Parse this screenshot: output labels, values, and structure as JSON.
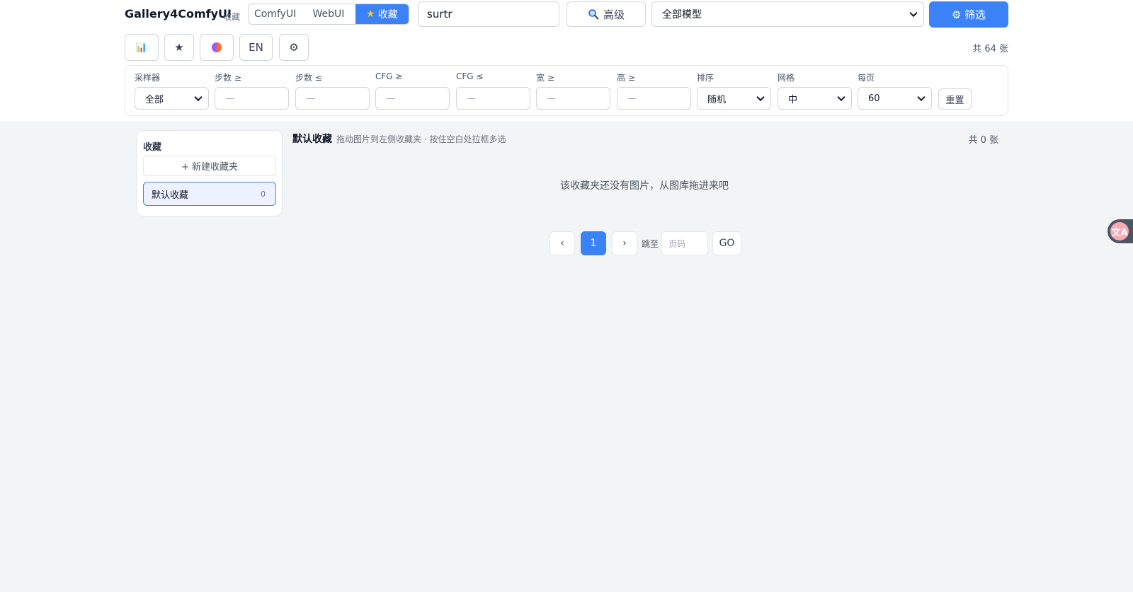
{
  "header": {
    "brand": "Gallery4ComfyUI",
    "brand_sub": "收藏",
    "sources": [
      {
        "label": "ComfyUI",
        "active": false
      },
      {
        "label": "WebUI",
        "active": false
      },
      {
        "label": "收藏",
        "active": true,
        "icon": "star-icon"
      }
    ],
    "search_value": "surtr",
    "advanced_label": "高级",
    "advanced_icon": "magnifier-icon",
    "model_select_value": "全部模型",
    "filter_button_label": "⚙ 筛选",
    "icon_buttons": [
      {
        "label": "📊",
        "icon": "bar-chart-icon"
      },
      {
        "label": "★",
        "icon": "star-icon"
      },
      {
        "label": "◑",
        "icon": "theme-icon"
      },
      {
        "label": "EN",
        "icon": "language-toggle"
      },
      {
        "label": "⚙",
        "icon": "settings-icon"
      }
    ],
    "total_text": "共 64 张"
  },
  "filters": {
    "sampler": {
      "label": "采样器",
      "value": "全部"
    },
    "steps_min": {
      "label": "步数 ≥",
      "placeholder": "—"
    },
    "steps_max": {
      "label": "步数 ≤",
      "placeholder": "—"
    },
    "cfg_min": {
      "label": "CFG ≥",
      "placeholder": "—"
    },
    "cfg_max": {
      "label": "CFG ≤",
      "placeholder": "—"
    },
    "width_min": {
      "label": "宽 ≥",
      "placeholder": "—"
    },
    "height_min": {
      "label": "高 ≥",
      "placeholder": "—"
    },
    "sort": {
      "label": "排序",
      "value": "随机"
    },
    "grid": {
      "label": "网格",
      "value": "中"
    },
    "per_page": {
      "label": "每页",
      "value": "60"
    },
    "reset_label": "重置"
  },
  "sidebar": {
    "title": "收藏",
    "new_folder_label": "+ 新建收藏夹",
    "folders": [
      {
        "name": "默认收藏",
        "count": "0",
        "active": true
      }
    ]
  },
  "main": {
    "title": "默认收藏",
    "hint": "拖动图片到左侧收藏夹 · 按住空白处拉框多选",
    "total_text": "共 0 张",
    "empty_text": "该收藏夹还没有图片，从图库拖进来吧"
  },
  "pagination": {
    "prev": "‹",
    "current": "1",
    "next": "›",
    "jump_label": "跳至",
    "jump_placeholder": "页码",
    "go_label": "GO"
  },
  "translate_widget": {
    "label": "文A"
  },
  "colors": {
    "accent": "#3b82f6",
    "page_bg": "#f3f4f6",
    "panel_bg": "#ffffff",
    "border": "#d1d5db",
    "star": "#facc15"
  }
}
